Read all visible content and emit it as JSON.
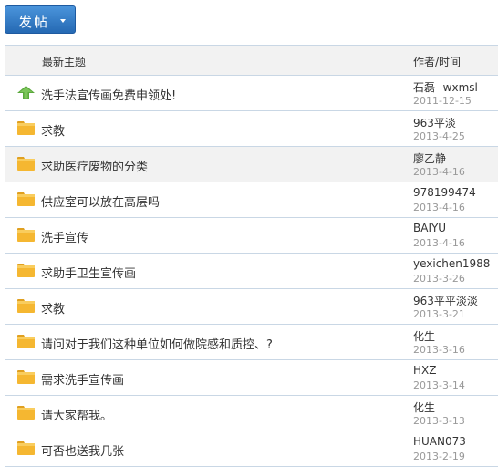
{
  "toolbar": {
    "post_label": "发帖"
  },
  "table": {
    "col_topic": "最新主题",
    "col_author": "作者/时间",
    "rows": [
      {
        "icon": "pinned-arrow-icon",
        "title": "洗手法宣传画免费申领处!",
        "author": "石磊--wxmsl",
        "date": "2011-12-15"
      },
      {
        "icon": "folder-icon",
        "title": "求教",
        "author": "963平淡",
        "date": "2013-4-25"
      },
      {
        "icon": "folder-icon",
        "title": "求助医疗废物的分类",
        "author": "廖乙静",
        "date": "2013-4-16"
      },
      {
        "icon": "folder-icon",
        "title": "供应室可以放在高层吗",
        "author": "978199474",
        "date": "2013-4-16"
      },
      {
        "icon": "folder-icon",
        "title": "洗手宣传",
        "author": "BAIYU",
        "date": "2013-4-16"
      },
      {
        "icon": "folder-icon",
        "title": "求助手卫生宣传画",
        "author": "yexichen1988",
        "date": "2013-3-26"
      },
      {
        "icon": "folder-icon",
        "title": "求教",
        "author": "963平平淡淡",
        "date": "2013-3-21"
      },
      {
        "icon": "folder-icon",
        "title": "请问对于我们这种单位如何做院感和质控、?",
        "author": "化生",
        "date": "2013-3-16"
      },
      {
        "icon": "folder-icon",
        "title": "需求洗手宣传画",
        "author": "HXZ",
        "date": "2013-3-14"
      },
      {
        "icon": "folder-icon",
        "title": "请大家帮我。",
        "author": "化生",
        "date": "2013-3-13"
      },
      {
        "icon": "folder-icon",
        "title": "可否也送我几张",
        "author": "HUAN073",
        "date": "2013-2-19"
      }
    ]
  },
  "colors": {
    "button": "#2f7cc8",
    "border": "#c9d7e5",
    "folder": "#f5b731",
    "pin": "#5aa83c"
  }
}
